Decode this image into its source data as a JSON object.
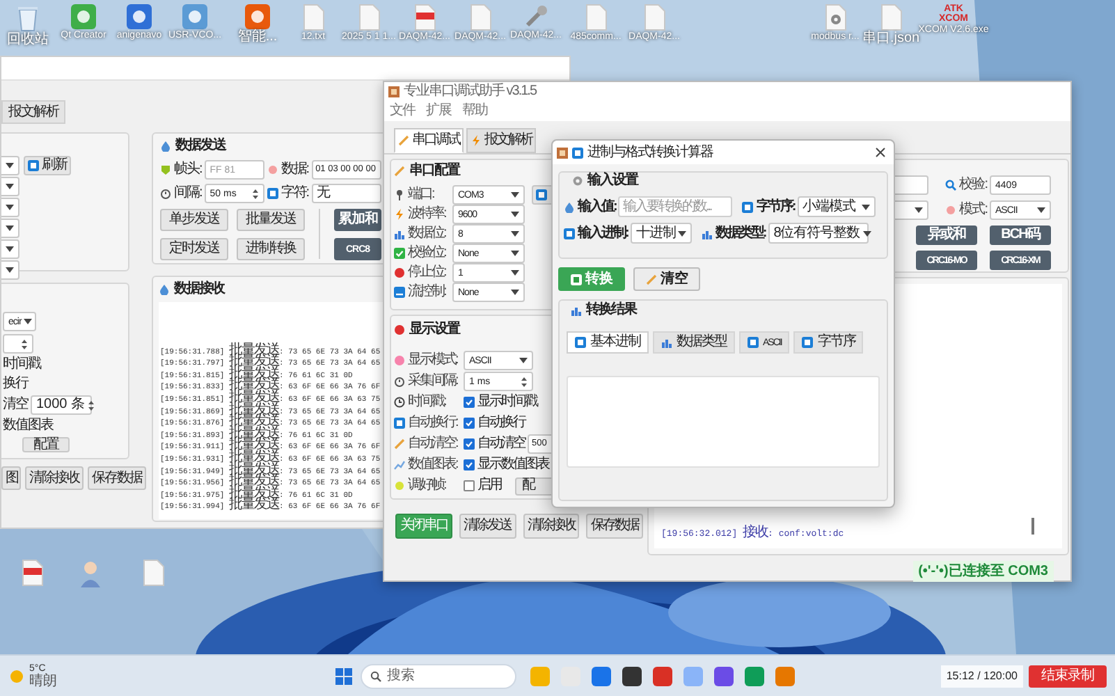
{
  "desktop": {
    "icons": [
      {
        "kind": "bin",
        "label": "回收站"
      },
      {
        "kind": "app",
        "color": "#3fae49",
        "label": "Qt Creator"
      },
      {
        "kind": "app",
        "color": "#2f6fd6",
        "label": "anigenavo"
      },
      {
        "kind": "app",
        "color": "#5b9bd5",
        "label": "USR-VCO..."
      },
      {
        "kind": "app",
        "color": "#e8590c",
        "label": "智能..."
      },
      {
        "kind": "file",
        "label": "12.txt"
      },
      {
        "kind": "file",
        "label": "2025 5 1 1..."
      },
      {
        "kind": "pdf",
        "label": "DAQM-42..."
      },
      {
        "kind": "file",
        "label": "DAQM-42..."
      },
      {
        "kind": "tool",
        "label": "DAQM-42..."
      },
      {
        "kind": "file",
        "label": "485comm..."
      },
      {
        "kind": "file",
        "label": "DAQM-42..."
      },
      {
        "kind": "gear",
        "label": "modbus r..."
      },
      {
        "kind": "file",
        "label": "串口.json"
      },
      {
        "kind": "logo",
        "logo_lines": [
          "ATK",
          "XCOM"
        ],
        "label": "XCOM V2.6.exe"
      }
    ],
    "lower_icons": [
      {
        "kind": "pdf"
      },
      {
        "kind": "figure"
      },
      {
        "kind": "file"
      }
    ]
  },
  "back_window": {
    "tabs": [
      {
        "label": "报文解析",
        "selected": false
      }
    ],
    "refresh_button": "刷新",
    "display": {
      "mode": "ecir",
      "timestamp": "时间戳",
      "wrap": "换行",
      "clear_label": "清空",
      "clear_count": "1000 条",
      "chart": "数值图表",
      "config_button": "配置"
    },
    "buttons": [
      "图",
      "清除接收",
      "保存数据"
    ],
    "send": {
      "title": "数据发送",
      "frame_head_label": "帧头:",
      "frame_head_placeholder": "FF 81",
      "data_label": "数据:",
      "data": "01 03 00 00 00",
      "interval_label": "间隔:",
      "interval": "50 ms",
      "char_label": "字符:",
      "char": "无",
      "buttons": [
        "单步发送",
        "批量发送",
        "定时发送",
        "进制转换"
      ],
      "dark_buttons": [
        "累加和",
        "CRC8"
      ]
    },
    "receive": {
      "title": "数据接收",
      "lines": [
        "[19:56:31.788] 批量发送: 73 65 6E 73 3A 64 65",
        "[19:56:31.797] 批量发送: 73 65 6E 73 3A 64 65",
        "[19:56:31.815] 批量发送: 76 61 6C 31 0D",
        "[19:56:31.833] 批量发送: 63 6F 6E 66 3A 76 6F",
        "[19:56:31.851] 批量发送: 63 6F 6E 66 3A 63 75",
        "[19:56:31.869] 批量发送: 73 65 6E 73 3A 64 65",
        "[19:56:31.876] 批量发送: 73 65 6E 73 3A 64 65",
        "[19:56:31.893] 批量发送: 76 61 6C 31 0D",
        "[19:56:31.911] 批量发送: 63 6F 6E 66 3A 76 6F",
        "[19:56:31.931] 批量发送: 63 6F 6E 66 3A 63 75",
        "[19:56:31.949] 批量发送: 73 65 6E 73 3A 64 65",
        "[19:56:31.956] 批量发送: 73 65 6E 73 3A 64 65",
        "[19:56:31.975] 批量发送: 76 61 6C 31 0D",
        "[19:56:31.994] 批量发送: 63 6F 6E 66 3A 76 6F"
      ]
    }
  },
  "main_window": {
    "title": "专业串口调试助手 v3.1.5",
    "menu": [
      "文件",
      "扩展",
      "帮助"
    ],
    "tabs": [
      {
        "label": "串口调试",
        "selected": true
      },
      {
        "label": "报文解析",
        "selected": false
      }
    ],
    "serial_config": {
      "title": "串口配置",
      "rows": [
        {
          "label": "端口:",
          "value": "COM3"
        },
        {
          "label": "波特率:",
          "value": "9600"
        },
        {
          "label": "数据位:",
          "value": "8"
        },
        {
          "label": "校验位:",
          "value": "None"
        },
        {
          "label": "停止位:",
          "value": "1"
        },
        {
          "label": "流控制:",
          "value": "None"
        }
      ]
    },
    "display_settings": {
      "title": "显示设置",
      "rows": [
        {
          "kind": "select",
          "label": "显示模式:",
          "value": "ASCII"
        },
        {
          "kind": "spin",
          "label": "采集间隔:",
          "value": "1 ms"
        },
        {
          "kind": "check",
          "label": "时间戳:",
          "option": "显示时间戳",
          "checked": true
        },
        {
          "kind": "check",
          "label": "自动换行:",
          "option": "自动换行",
          "checked": true
        },
        {
          "kind": "check",
          "label": "自动清空:",
          "option": "自动清空",
          "checked": true,
          "extra": "500"
        },
        {
          "kind": "check",
          "label": "数值图表:",
          "option": "显示数值图表",
          "checked": true
        },
        {
          "kind": "check",
          "label": "调好帧:",
          "option": "启用",
          "checked": false,
          "button": "配"
        }
      ]
    },
    "buttons": [
      {
        "kind": "primary",
        "label": "关闭串口"
      },
      {
        "kind": "plain",
        "label": "清除发送"
      },
      {
        "kind": "plain",
        "label": "清除接收"
      },
      {
        "kind": "plain",
        "label": "保存数据"
      }
    ],
    "checksum": {
      "check_label": "校验:",
      "check_value": "4409",
      "mode_label": "模式:",
      "mode_value": "ASCII",
      "buttons": [
        "异或和",
        "BCH码",
        "CRC16-MO",
        "CRC16-XM"
      ]
    },
    "log": [
      "[19:56:32.012] 接收: conf:volt:dc"
    ],
    "status": "(•'-'•)已连接至 COM3"
  },
  "dialog": {
    "title": "进制与格式转换计算器",
    "input_group": {
      "title": "输入设置",
      "value_label": "输入值:",
      "value_placeholder": "输入要转换的数...",
      "byte_order_label": "字节序:",
      "byte_order": "小端模式",
      "base_label": "输入进制:",
      "base": "十进制",
      "type_label": "数据类型:",
      "type": "8位有符号整数"
    },
    "convert_button": "转换",
    "clear_button": "清空",
    "result_group": {
      "title": "转换结果",
      "tabs": [
        {
          "label": "基本进制",
          "selected": true
        },
        {
          "label": "数据类型",
          "selected": false
        },
        {
          "label": "ASCII",
          "selected": false
        },
        {
          "label": "字节序",
          "selected": false
        }
      ]
    }
  },
  "taskbar": {
    "temperature": "5°C",
    "weather": "晴朗",
    "search_placeholder": "搜索",
    "timer": "15:12 / 120:00",
    "stop_button": "结束录制"
  }
}
